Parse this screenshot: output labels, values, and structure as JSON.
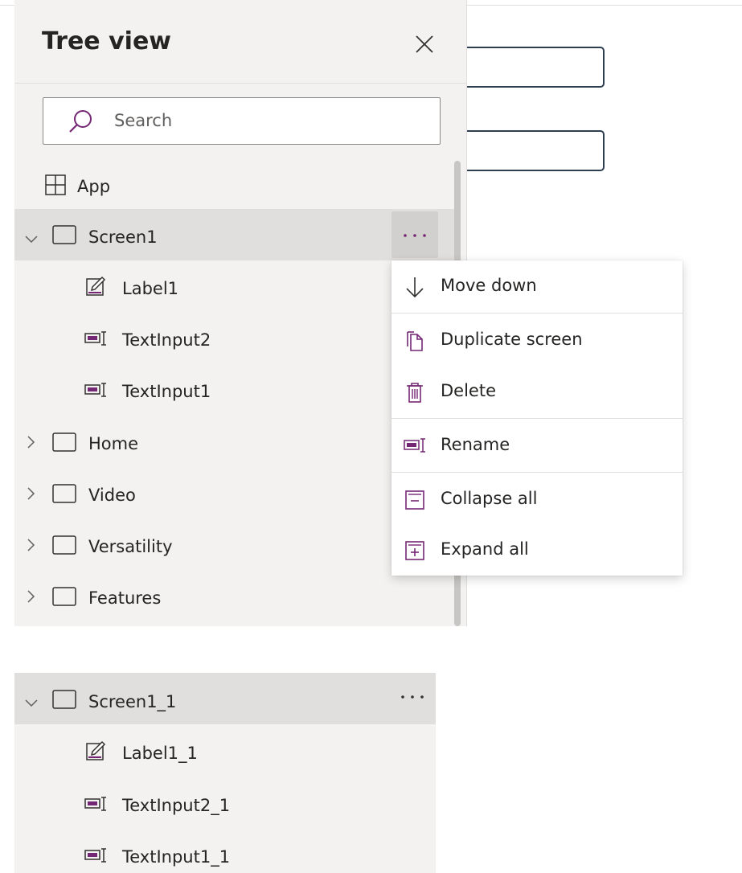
{
  "panel": {
    "title": "Tree view",
    "search_placeholder": "Search"
  },
  "tree": {
    "app": "App",
    "screen1": "Screen1",
    "label1": "Label1",
    "textinput2": "TextInput2",
    "textinput1": "TextInput1",
    "home": "Home",
    "video": "Video",
    "versatility": "Versatility",
    "features": "Features"
  },
  "menu": {
    "move_down": "Move down",
    "duplicate_screen": "Duplicate screen",
    "delete": "Delete",
    "rename": "Rename",
    "collapse_all": "Collapse all",
    "expand_all": "Expand all"
  },
  "tree2": {
    "screen1_1": "Screen1_1",
    "label1_1": "Label1_1",
    "textinput2_1": "TextInput2_1",
    "textinput1_1": "TextInput1_1"
  },
  "colors": {
    "accent": "#742774",
    "panel_bg": "#f3f2f1",
    "selected_bg": "#e1dfdd",
    "text": "#252423"
  }
}
